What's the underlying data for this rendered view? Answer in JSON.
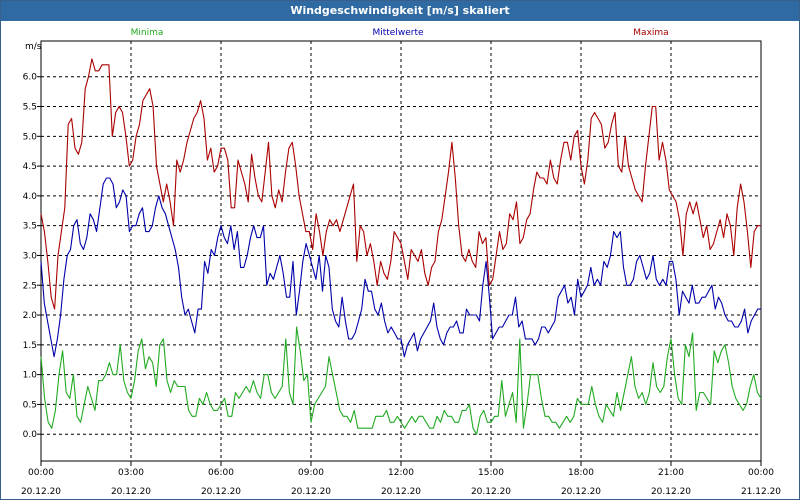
{
  "window": {
    "title": "Windgeschwindigkeit [m/s] skaliert"
  },
  "chart_data": {
    "type": "line",
    "ylabel": "m/s",
    "ylim": [
      -0.45,
      6.6
    ],
    "xlim_hours": [
      0,
      24
    ],
    "y_ticks": [
      "0.0",
      "0.5",
      "1.0",
      "1.5",
      "2.0",
      "2.5",
      "3.0",
      "3.5",
      "4.0",
      "4.5",
      "5.0",
      "5.5",
      "6.0"
    ],
    "x_ticks": [
      {
        "time": "00:00",
        "date": "20.12.20"
      },
      {
        "time": "03:00",
        "date": "20.12.20"
      },
      {
        "time": "06:00",
        "date": "20.12.20"
      },
      {
        "time": "09:00",
        "date": "20.12.20"
      },
      {
        "time": "12:00",
        "date": "20.12.20"
      },
      {
        "time": "15:00",
        "date": "20.12.20"
      },
      {
        "time": "18:00",
        "date": "20.12.20"
      },
      {
        "time": "21:00",
        "date": "20.12.20"
      },
      {
        "time": "00:00",
        "date": "21.12.20"
      }
    ],
    "grid": true,
    "series": [
      {
        "name": "Minima",
        "color": "#22aa22",
        "values": [
          1.3,
          0.6,
          0.2,
          0.1,
          0.4,
          1.0,
          1.4,
          0.7,
          0.6,
          1.0,
          0.3,
          0.2,
          0.5,
          0.8,
          0.6,
          0.4,
          0.9,
          0.9,
          1.0,
          1.2,
          1.0,
          1.0,
          1.5,
          0.9,
          0.7,
          0.6,
          0.9,
          1.4,
          1.6,
          1.1,
          1.3,
          1.2,
          0.8,
          1.5,
          1.6,
          0.9,
          0.7,
          0.9,
          0.8,
          0.8,
          0.8,
          0.4,
          0.3,
          0.3,
          0.6,
          0.5,
          0.7,
          0.5,
          0.4,
          0.4,
          0.5,
          0.6,
          0.3,
          0.3,
          0.7,
          0.6,
          0.7,
          0.8,
          0.7,
          0.9,
          0.7,
          0.6,
          1.0,
          1.0,
          0.7,
          0.6,
          0.7,
          0.8,
          1.6,
          0.7,
          0.5,
          1.8,
          1.4,
          0.9,
          1.0,
          0.2,
          0.5,
          0.6,
          0.7,
          0.8,
          1.3,
          1.0,
          0.7,
          0.4,
          0.3,
          0.3,
          0.2,
          0.4,
          0.1,
          0.1,
          0.1,
          0.1,
          0.1,
          0.3,
          0.3,
          0.3,
          0.4,
          0.2,
          0.2,
          0.3,
          0.2,
          0.1,
          0.2,
          0.3,
          0.2,
          0.3,
          0.3,
          0.2,
          0.1,
          0.1,
          0.3,
          0.2,
          0.4,
          0.3,
          0.3,
          0.2,
          0.2,
          0.4,
          0.4,
          0.5,
          0.1,
          0.0,
          0.3,
          0.4,
          0.2,
          0.2,
          0.3,
          0.3,
          0.9,
          0.3,
          0.5,
          0.7,
          0.2,
          1.6,
          0.1,
          0.5,
          1.0,
          1.0,
          1.0,
          0.6,
          0.3,
          0.3,
          0.2,
          0.2,
          0.1,
          0.2,
          0.3,
          0.2,
          0.3,
          0.6,
          0.5,
          0.5,
          0.5,
          0.8,
          0.5,
          0.3,
          0.2,
          0.5,
          0.4,
          0.3,
          0.7,
          0.4,
          0.7,
          1.0,
          1.3,
          0.8,
          0.6,
          0.7,
          0.5,
          0.7,
          1.2,
          0.8,
          0.7,
          0.8,
          1.3,
          1.6,
          1.0,
          0.6,
          0.5,
          1.5,
          1.3,
          1.7,
          0.4,
          0.7,
          0.7,
          0.6,
          0.5,
          1.4,
          1.2,
          1.4,
          1.5,
          1.2,
          0.8,
          0.6,
          0.5,
          0.4,
          0.5,
          0.8,
          1.0,
          0.7,
          0.6
        ]
      },
      {
        "name": "Mittelwerte",
        "color": "#0000aa",
        "values": [
          2.9,
          2.2,
          1.9,
          1.6,
          1.3,
          1.6,
          2.0,
          2.6,
          3.0,
          3.1,
          3.5,
          3.6,
          3.2,
          3.1,
          3.3,
          3.7,
          3.6,
          3.4,
          3.8,
          4.2,
          4.3,
          4.3,
          4.2,
          3.8,
          3.9,
          4.1,
          4.0,
          3.4,
          3.5,
          3.5,
          3.7,
          3.8,
          3.4,
          3.4,
          3.5,
          3.8,
          4.0,
          3.8,
          3.7,
          3.5,
          3.3,
          3.1,
          2.8,
          2.3,
          2.0,
          2.1,
          1.9,
          1.7,
          2.1,
          2.1,
          2.9,
          2.7,
          3.1,
          3.0,
          3.3,
          3.5,
          3.3,
          3.2,
          3.5,
          3.1,
          3.4,
          2.8,
          2.8,
          3.0,
          3.3,
          3.5,
          3.3,
          3.3,
          3.5,
          2.5,
          2.7,
          2.6,
          2.8,
          3.0,
          2.7,
          2.3,
          2.3,
          2.9,
          2.0,
          2.4,
          2.9,
          3.2,
          3.0,
          2.8,
          2.6,
          3.0,
          2.4,
          3.0,
          2.8,
          2.1,
          1.9,
          1.8,
          2.3,
          1.9,
          1.6,
          1.6,
          1.7,
          1.9,
          2.1,
          2.6,
          2.4,
          2.4,
          2.1,
          2.0,
          2.2,
          1.9,
          1.7,
          1.8,
          1.7,
          1.6,
          1.6,
          1.3,
          1.5,
          1.6,
          1.7,
          1.4,
          1.6,
          1.7,
          1.8,
          1.9,
          2.2,
          1.8,
          1.6,
          1.5,
          1.7,
          1.8,
          1.8,
          1.9,
          1.7,
          1.7,
          2.1,
          2.0,
          2.0,
          2.0,
          1.9,
          2.5,
          2.9,
          2.3,
          1.6,
          1.7,
          1.8,
          1.8,
          1.9,
          2.0,
          2.0,
          2.3,
          1.8,
          1.9,
          1.6,
          1.6,
          1.6,
          1.5,
          1.6,
          1.8,
          1.8,
          1.7,
          1.8,
          1.9,
          2.3,
          2.4,
          2.5,
          2.2,
          2.3,
          2.0,
          2.6,
          2.3,
          2.4,
          2.5,
          2.8,
          2.5,
          2.6,
          2.5,
          2.9,
          2.8,
          3.0,
          3.4,
          3.3,
          3.4,
          2.8,
          2.5,
          2.5,
          2.6,
          2.9,
          3.0,
          2.8,
          2.6,
          2.7,
          3.0,
          2.6,
          2.5,
          2.6,
          2.5,
          2.9,
          2.9,
          2.6,
          2.0,
          2.4,
          2.3,
          2.2,
          2.5,
          2.2,
          2.2,
          2.3,
          2.3,
          2.4,
          2.5,
          2.1,
          2.3,
          2.2,
          2.0,
          1.9,
          1.9,
          1.8,
          1.8,
          1.9,
          2.1,
          1.7,
          1.9,
          2.0,
          2.1,
          2.1
        ]
      },
      {
        "name": "Maxima",
        "color": "#aa0000",
        "values": [
          3.7,
          3.4,
          2.9,
          2.3,
          2.1,
          3.0,
          3.4,
          3.8,
          5.2,
          5.3,
          4.8,
          4.7,
          4.9,
          5.8,
          6.0,
          6.3,
          6.1,
          6.1,
          6.2,
          6.2,
          6.2,
          5.0,
          5.4,
          5.5,
          5.4,
          5.0,
          4.5,
          4.6,
          5.0,
          5.2,
          5.6,
          5.7,
          5.8,
          5.5,
          4.5,
          4.2,
          3.9,
          4.2,
          3.9,
          3.5,
          4.6,
          4.4,
          4.6,
          4.9,
          5.1,
          5.3,
          5.4,
          5.6,
          5.3,
          4.6,
          4.8,
          4.4,
          4.5,
          4.8,
          4.8,
          4.6,
          3.8,
          3.8,
          4.6,
          4.4,
          4.2,
          3.9,
          4.7,
          4.3,
          4.0,
          3.9,
          4.4,
          4.9,
          4.0,
          3.8,
          4.1,
          3.9,
          4.4,
          4.8,
          4.9,
          4.5,
          4.0,
          3.7,
          3.4,
          3.4,
          3.1,
          3.7,
          3.4,
          3.0,
          3.4,
          3.6,
          3.5,
          3.6,
          3.4,
          3.6,
          3.8,
          4.0,
          4.2,
          2.9,
          3.5,
          3.4,
          3.0,
          3.2,
          2.9,
          2.5,
          2.9,
          2.7,
          2.6,
          2.9,
          3.4,
          3.3,
          3.2,
          2.9,
          2.6,
          3.1,
          3.0,
          2.9,
          3.1,
          2.7,
          2.5,
          2.8,
          2.9,
          3.4,
          3.6,
          4.0,
          4.4,
          4.9,
          4.3,
          3.5,
          3.0,
          2.9,
          3.1,
          2.9,
          2.8,
          3.4,
          3.2,
          3.3,
          2.5,
          2.6,
          3.0,
          3.4,
          3.1,
          3.2,
          3.7,
          3.6,
          3.9,
          3.2,
          3.3,
          3.6,
          3.7,
          4.1,
          4.4,
          4.3,
          4.3,
          4.2,
          4.6,
          4.3,
          4.2,
          4.6,
          4.9,
          4.9,
          4.6,
          5.0,
          5.1,
          4.5,
          4.2,
          4.6,
          5.3,
          5.4,
          5.3,
          5.2,
          4.8,
          4.9,
          5.2,
          5.4,
          4.5,
          4.4,
          5.0,
          4.5,
          4.3,
          4.1,
          4.0,
          3.9,
          4.5,
          5.0,
          5.5,
          5.5,
          4.6,
          4.9,
          4.6,
          4.1,
          4.0,
          3.9,
          3.6,
          3.0,
          3.7,
          3.9,
          3.7,
          3.9,
          3.6,
          3.3,
          3.5,
          3.1,
          3.2,
          3.4,
          3.6,
          3.3,
          3.7,
          3.5,
          3.0,
          3.8,
          4.2,
          3.9,
          3.4,
          2.8,
          3.4,
          3.5,
          3.5
        ]
      }
    ]
  }
}
